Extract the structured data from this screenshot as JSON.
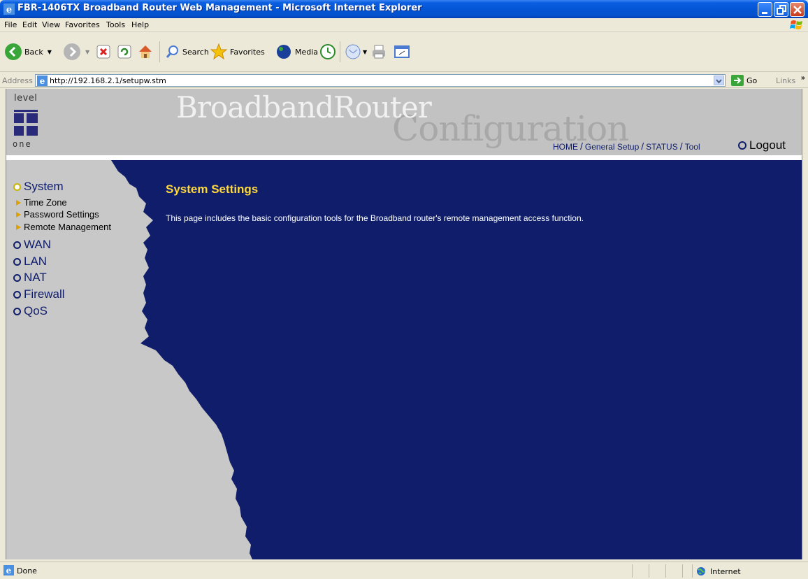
{
  "window": {
    "title": "FBR-1406TX Broadband Router Web Management - Microsoft Internet Explorer"
  },
  "menu": [
    "File",
    "Edit",
    "View",
    "Favorites",
    "Tools",
    "Help"
  ],
  "toolbar": {
    "back_label": "Back",
    "search_label": "Search",
    "favorites_label": "Favorites",
    "media_label": "Media"
  },
  "address": {
    "label": "Address",
    "url": "http://192.168.2.1/setupw.stm",
    "go_label": "Go",
    "links_label": "Links"
  },
  "banner": {
    "logo_top": "level",
    "logo_bottom": "one",
    "title_main": "BroadbandRouter",
    "title_sub": "Configuration",
    "nav": [
      "HOME",
      "General Setup",
      "STATUS",
      "Tool"
    ],
    "logout": "Logout"
  },
  "sidebar": {
    "items": [
      {
        "label": "System",
        "active": true
      },
      {
        "label": "WAN"
      },
      {
        "label": "LAN"
      },
      {
        "label": "NAT"
      },
      {
        "label": "Firewall"
      },
      {
        "label": "QoS"
      }
    ],
    "subitems": [
      "Time Zone",
      "Password Settings",
      "Remote Management"
    ]
  },
  "main": {
    "title": "System Settings",
    "description": "This page includes the basic configuration tools for the Broadband router's remote management access function."
  },
  "status": {
    "text": "Done",
    "zone": "Internet"
  },
  "colors": {
    "content_bg": "#0f1d6b",
    "sidebar_bg": "#c8c8c8",
    "title_yellow": "#ffd93b",
    "banner_bg": "#c2c2c2"
  }
}
